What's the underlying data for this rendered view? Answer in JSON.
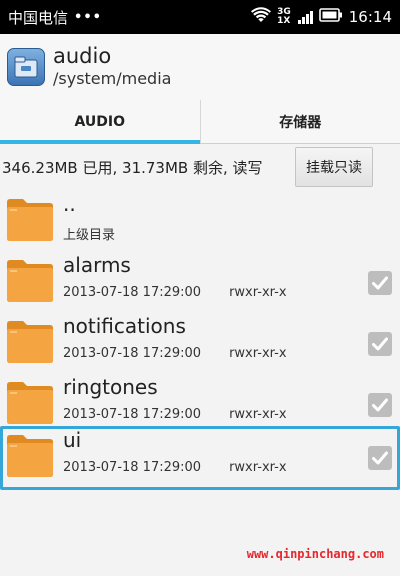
{
  "status_bar": {
    "carrier": "中国电信",
    "dots": "•••",
    "network_top": "3G",
    "network_bottom": "1X",
    "time": "16:14"
  },
  "header": {
    "title": "audio",
    "path": "/system/media",
    "icon": "file-manager-app-icon"
  },
  "tabs": [
    {
      "label": "AUDIO",
      "active": true
    },
    {
      "label": "存储器",
      "active": false
    }
  ],
  "storage": {
    "info": "346.23MB 已用, 31.73MB 剩余, 读写",
    "mount_button": "挂载只读"
  },
  "files": [
    {
      "name": "..",
      "meta": "上级目录",
      "date": "",
      "perms": "",
      "checkbox": false
    },
    {
      "name": "alarms",
      "date": "2013-07-18 17:29:00",
      "perms": "rwxr-xr-x",
      "checkbox": true
    },
    {
      "name": "notifications",
      "date": "2013-07-18 17:29:00",
      "perms": "rwxr-xr-x",
      "checkbox": true
    },
    {
      "name": "ringtones",
      "date": "2013-07-18 17:29:00",
      "perms": "rwxr-xr-x",
      "checkbox": true
    },
    {
      "name": "ui",
      "date": "2013-07-18 17:29:00",
      "perms": "rwxr-xr-x",
      "checkbox": true,
      "selected": true
    }
  ],
  "watermark": "www.qinpinchang.com",
  "colors": {
    "accent": "#33b5e5",
    "folder": "#f5a442",
    "watermark": "#e8262c"
  }
}
